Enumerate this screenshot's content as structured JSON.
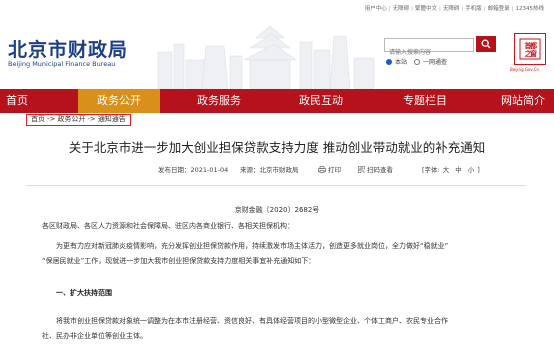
{
  "util_links": [
    "用户中心",
    "无障碍",
    "繁體中文",
    "无障碍",
    "手机版",
    "邮箱登录",
    "12345热线"
  ],
  "header": {
    "title": "北京市财政局",
    "subtitle": "Beijing Municipal Finance Bureau",
    "search_placeholder": "请输入搜索内容",
    "scope_site": "本站",
    "scope_all": "一网通查",
    "logo_text": "首都之窗",
    "logo_caption": "Beijing.Gov.Cn"
  },
  "nav": [
    "首页",
    "政务公开",
    "政务服务",
    "政民互动",
    "专题栏目",
    "网站简介"
  ],
  "breadcrumb": [
    "首页",
    "政务公开",
    "通知通告"
  ],
  "breadcrumb_sep": "->",
  "article": {
    "title": "关于北京市进一步加大创业担保贷款支持力度 推动创业带动就业的补充通知",
    "publish_label": "发布日期：",
    "publish_date": "2021-01-04",
    "source_label": "来源：",
    "source": "北京市财政局",
    "print_label": "打印",
    "scan_label": "扫码查看",
    "font_label": "[字体:",
    "font_sizes": [
      "大",
      "中",
      "小"
    ],
    "font_close": "]",
    "doc_number": "京财金融〔2020〕2682号",
    "p1": "各区财政局、各区人力资源和社会保障局、驻区内各商业银行、各相关担保机构：",
    "p2_l1": "为更有力应对新冠肺炎疫情影响，充分发挥创业担保贷款作用，持续激发市场主体活力，创造更多就业岗位，全力做好“稳就业”",
    "p2_l2": "“保居民就业”工作，现就进一步加大我市创业担保贷款支持力度相关事宜补充通知如下：",
    "heading": "一、扩大扶持范围",
    "p3_l1": "将我市创业担保贷款对象统一调整为在本市注册经营、资信良好、有具体经营项目的小型微型企业、个体工商户、农民专业合作",
    "p3_l2": "社、民办非企业单位等创业主体。"
  }
}
